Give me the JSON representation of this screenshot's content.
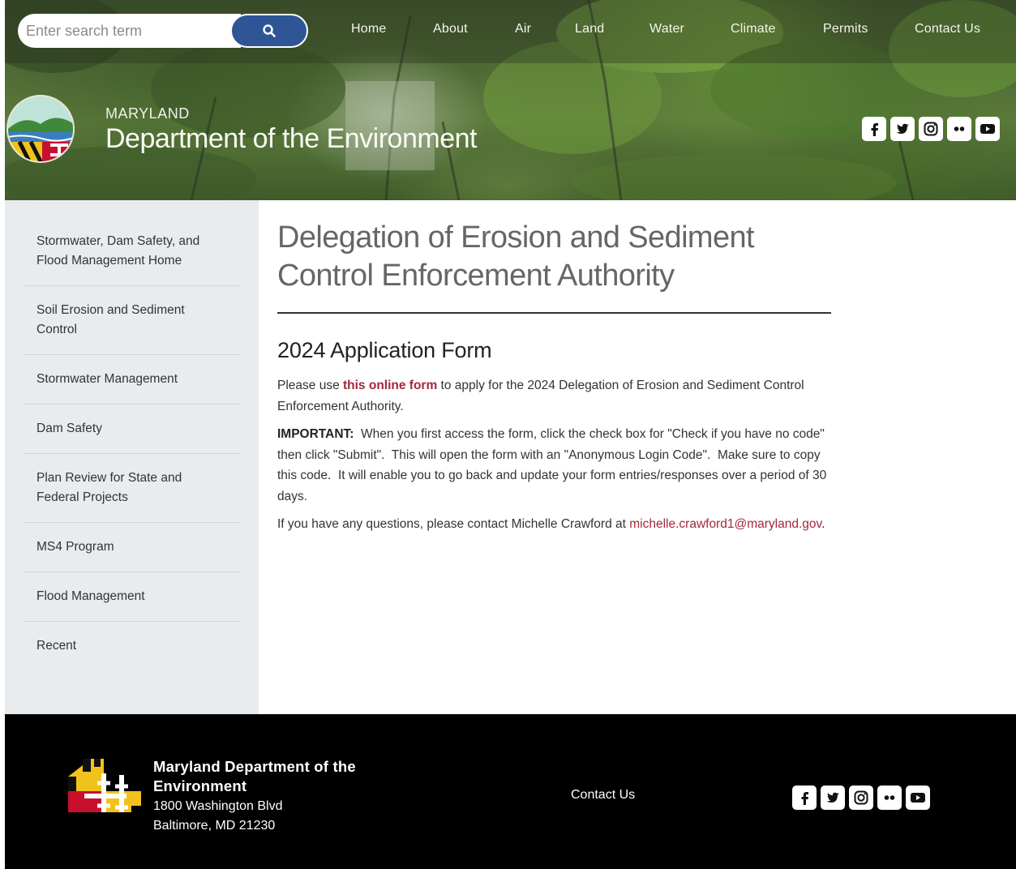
{
  "header": {
    "search": {
      "placeholder": "Enter search term"
    },
    "nav": [
      "Home",
      "About",
      "Air",
      "Land",
      "Water",
      "Climate",
      "Permits",
      "Contact Us"
    ],
    "brand": {
      "state": "MARYLAND",
      "department": "Department of the Environment"
    },
    "social_icons": [
      "facebook-icon",
      "twitter-icon",
      "instagram-icon",
      "flickr-icon",
      "youtube-icon"
    ]
  },
  "sidebar": {
    "items": [
      {
        "label": "Stormwater, Dam Safety, and Flood Management Home"
      },
      {
        "label": "Soil Erosion and Sediment Control"
      },
      {
        "label": "Stormwater Management"
      },
      {
        "label": "Dam Safety"
      },
      {
        "label": "Plan Review for State and Federal Projects"
      },
      {
        "label": "MS4 Program"
      },
      {
        "label": "Flood Management"
      },
      {
        "label": "Recent"
      }
    ]
  },
  "main": {
    "title": "Delegation of Erosion and Sediment Control Enforcement Authority",
    "section_title": "2024 Application Form",
    "p1": {
      "before": "Please use ",
      "link": "this online form",
      "after": " to apply for the 2024 Delegation of Erosion and Sediment Control Enforcement Authority."
    },
    "p2": {
      "label": "IMPORTANT:",
      "text": "  When you first access the form, click the check box for \"Check if you have no code\" then click \"Submit\".  This will open the form with an \"Anonymous Login Code\".  Make sure to copy this code.  It will enable you to go back and update your form entries/responses over a period of 30 days."
    },
    "p3": {
      "before": "If you have any questions, please contact Michelle Crawford at ",
      "email": "michelle.crawford1@maryland.gov",
      "after": "."
    }
  },
  "footer": {
    "org_line1": "Maryland Department of the",
    "org_line2": "Environment",
    "address_line1": "1800 Washington Blvd",
    "address_line2": "Baltimore, MD 21230",
    "contact_label": "Contact Us"
  },
  "colors": {
    "search_button": "#2f5596",
    "link": "#a3283a",
    "sidebar_bg": "#e9ecef",
    "footer_bg": "#000000"
  }
}
